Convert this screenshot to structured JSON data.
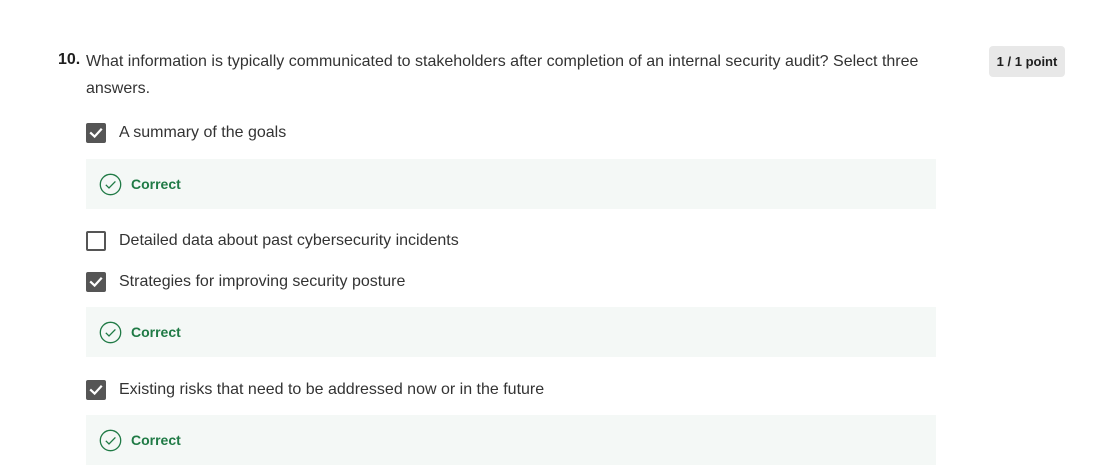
{
  "question": {
    "number": "10.",
    "text": "What information is typically communicated to stakeholders after completion of an internal security audit? Select three answers.",
    "points": "1 / 1 point"
  },
  "options": [
    {
      "label": "A summary of the goals",
      "checked": true,
      "feedback": "Correct"
    },
    {
      "label": "Detailed data about past cybersecurity incidents",
      "checked": false
    },
    {
      "label": "Strategies for improving security posture",
      "checked": true,
      "feedback": "Correct"
    },
    {
      "label": "Existing risks that need to be addressed now or in the future",
      "checked": true,
      "feedback": "Correct"
    }
  ],
  "icons": {
    "checkbox_checked": "checkmark-icon",
    "feedback": "check-circle-icon"
  },
  "colors": {
    "correct_text": "#1f7a45",
    "correct_background": "#f4f8f6",
    "checkbox_fill": "#555555",
    "badge_background": "#e8e8e8"
  }
}
